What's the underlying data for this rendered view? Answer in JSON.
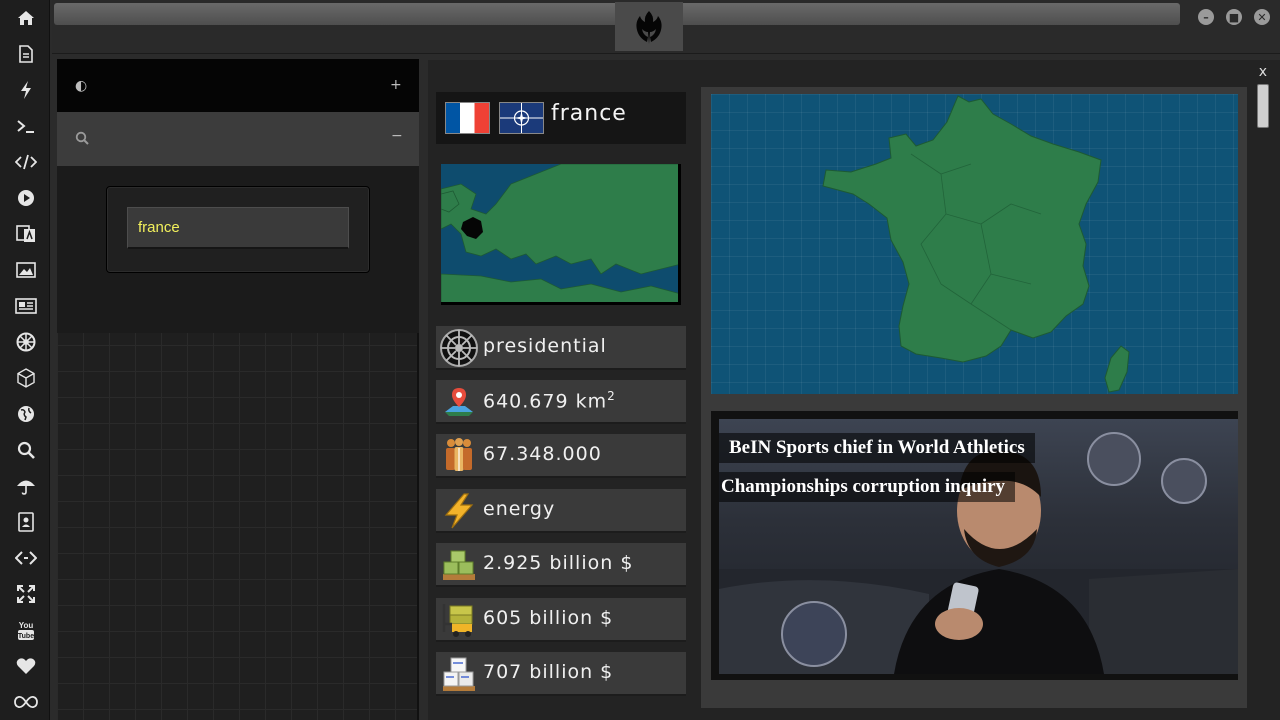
{
  "rail": {
    "icons": [
      "home-icon",
      "document-icon",
      "lightning-icon",
      "terminal-icon",
      "code-icon",
      "play-icon",
      "translate-icon",
      "image-icon",
      "newspaper-icon",
      "empire-icon",
      "polygon-icon",
      "globe-icon",
      "search-icon",
      "umbrella-icon",
      "contacts-icon",
      "code-brackets-icon",
      "expand-icon",
      "youtube-icon",
      "heart-icon",
      "infinity-icon"
    ]
  },
  "sidebar": {
    "search_value": "france"
  },
  "country": {
    "name": "france",
    "stats": [
      {
        "icon": "empire-icon",
        "value": "presidential"
      },
      {
        "icon": "map-pin-icon",
        "value": "640.679 km",
        "sup": "2"
      },
      {
        "icon": "people-icon",
        "value": "67.348.000"
      },
      {
        "icon": "lightning-icon",
        "value": "energy"
      },
      {
        "icon": "money-stack-icon",
        "value": "2.925 billion $"
      },
      {
        "icon": "forklift-icon",
        "value": "605 billion $"
      },
      {
        "icon": "boxes-icon",
        "value": "707 billion $"
      }
    ]
  },
  "news": {
    "headline_line1": "BeIN Sports chief in World Athletics",
    "headline_line2": "Championships corruption inquiry"
  },
  "panel": {
    "close_label": "x"
  },
  "colors": {
    "map_sea": "#0f5376",
    "map_land": "#2e7d4a",
    "search_text": "#f2f05c"
  }
}
